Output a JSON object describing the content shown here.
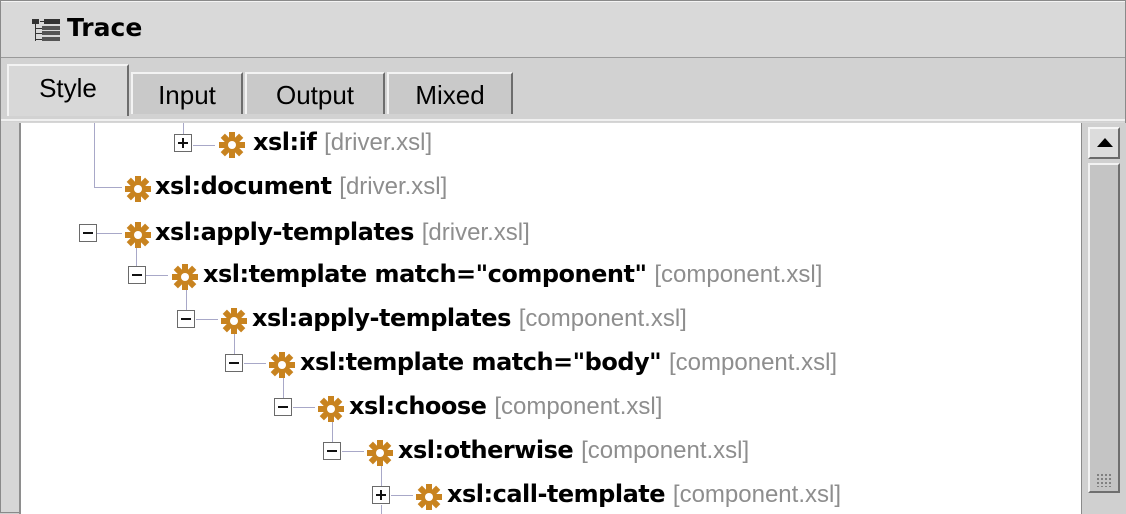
{
  "window": {
    "title": "Trace",
    "icon": "trace-tree-icon"
  },
  "tabs": [
    {
      "label": "Style",
      "active": true
    },
    {
      "label": "Input",
      "active": false
    },
    {
      "label": "Output",
      "active": false
    },
    {
      "label": "Mixed",
      "active": false
    }
  ],
  "tree": {
    "nodes": [
      {
        "expander": "plus",
        "label": "xsl:if",
        "file": "[driver.xsl]"
      },
      {
        "expander": "none",
        "label": "xsl:document",
        "file": "[driver.xsl]"
      },
      {
        "expander": "minus",
        "label": "xsl:apply-templates",
        "file": "[driver.xsl]"
      },
      {
        "expander": "minus",
        "label": "xsl:template match=\"component\"",
        "file": "[component.xsl]"
      },
      {
        "expander": "minus",
        "label": "xsl:apply-templates",
        "file": "[component.xsl]"
      },
      {
        "expander": "minus",
        "label": "xsl:template match=\"body\"",
        "file": "[component.xsl]"
      },
      {
        "expander": "minus",
        "label": "xsl:choose",
        "file": "[component.xsl]"
      },
      {
        "expander": "minus",
        "label": "xsl:otherwise",
        "file": "[component.xsl]"
      },
      {
        "expander": "plus",
        "label": "xsl:call-template",
        "file": "[component.xsl]"
      }
    ],
    "node_icon": "gear-icon",
    "colors": {
      "gear": "#c8831f",
      "file_text": "#8e8e8e",
      "tree_line": "#a8a8c8"
    }
  },
  "scrollbar": {
    "up_icon": "arrow-up-icon"
  }
}
